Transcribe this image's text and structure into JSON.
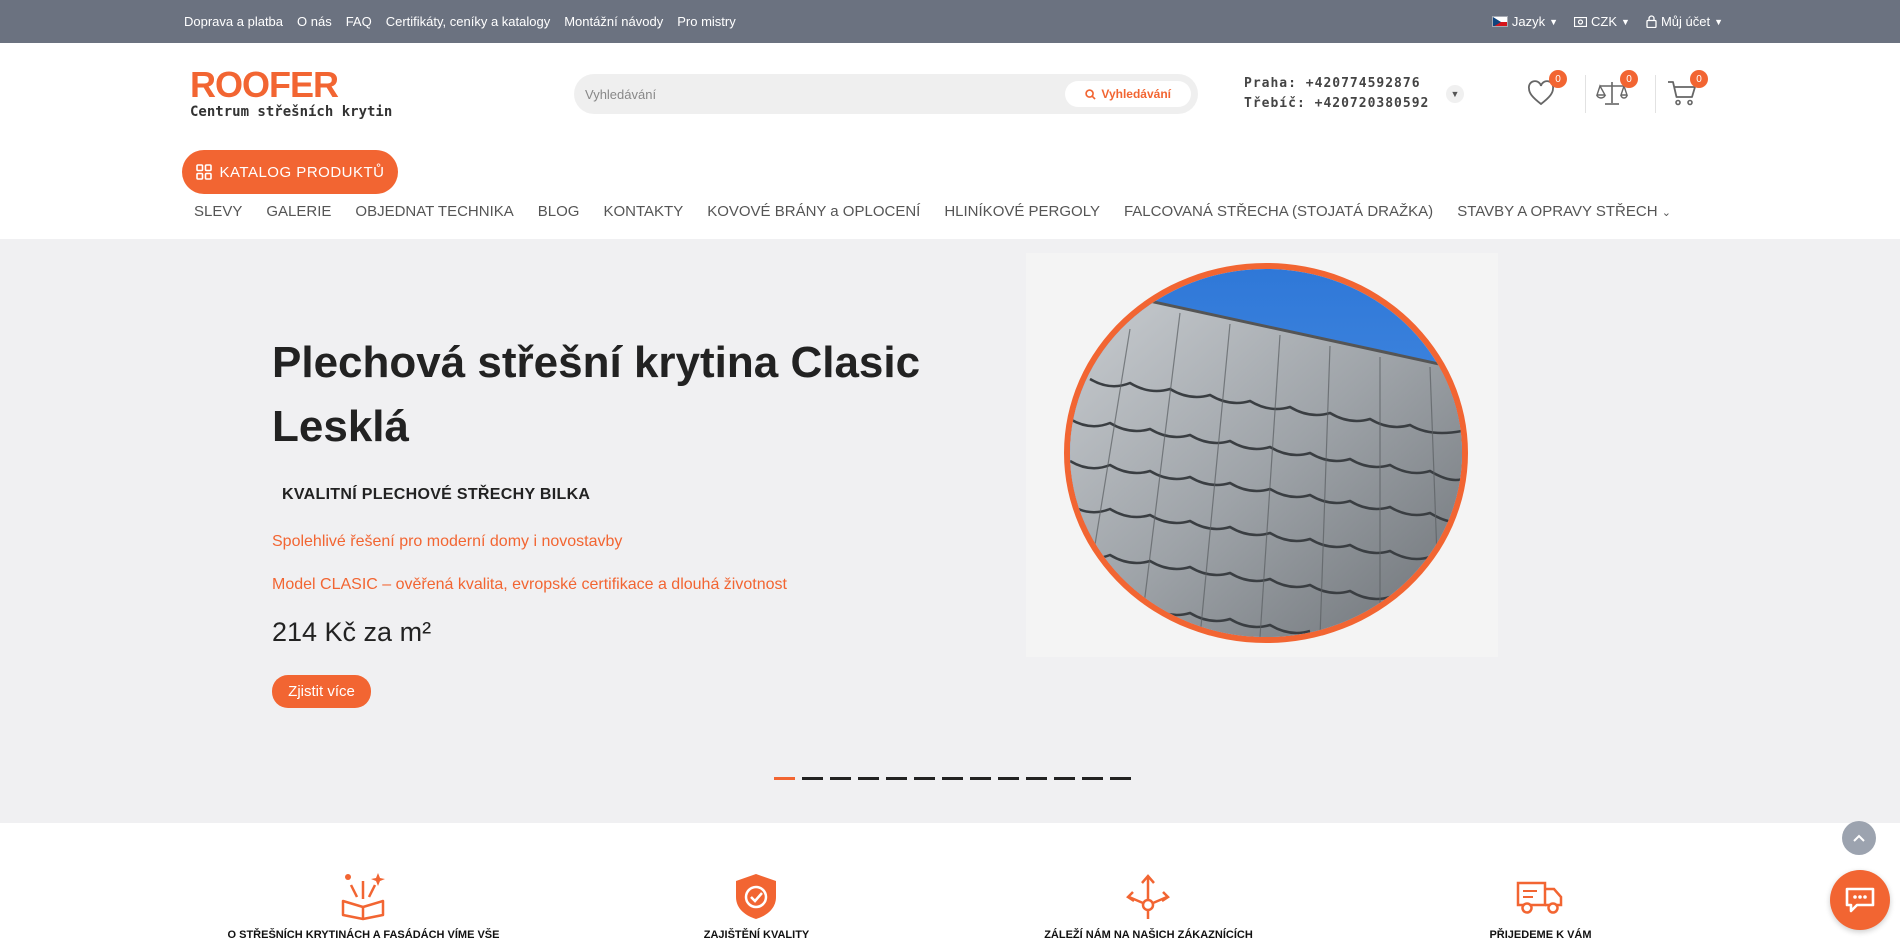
{
  "topbar": {
    "links": [
      "Doprava a platba",
      "O nás",
      "FAQ",
      "Certifikáty, ceníky a katalogy",
      "Montážní návody",
      "Pro mistry"
    ],
    "language": "Jazyk",
    "currency": "CZK",
    "account": "Můj účet"
  },
  "header": {
    "logo_word": "ROOFER",
    "logo_sub": "Centrum střešních krytin",
    "search_placeholder": "Vyhledávání",
    "search_button": "Vyhledávání",
    "phone_praha": "Praha: +420774592876",
    "phone_trebic": "Třebíč: +420720380592",
    "wishlist_count": "0",
    "compare_count": "0",
    "cart_count": "0"
  },
  "nav": {
    "catalog_label": "KATALOG PRODUKTŮ",
    "items": [
      "SLEVY",
      "GALERIE",
      "OBJEDNAT TECHNIKA",
      "BLOG",
      "KONTAKTY",
      "KOVOVÉ BRÁNY a OPLOCENÍ",
      "HLINÍKOVÉ PERGOLY",
      "FALCOVANÁ STŘECHA (STOJATÁ DRAŽKA)",
      "STAVBY A OPRAVY STŘECH"
    ]
  },
  "hero": {
    "title": "Plechová střešní krytina Clasic Lesklá",
    "subtitle": "KVALITNÍ PLECHOVÉ STŘECHY BILKA",
    "line1": "Spolehlivé řešení pro moderní domy i novostavby",
    "line2": "Model CLASIC – ověřená kvalita, evropské certifikace a dlouhá životnost",
    "price": "214 Kč za m²",
    "button": "Zjistit více",
    "slide_count": 13,
    "active_slide": 1
  },
  "features": [
    {
      "icon": "book-icon",
      "text": "O STŘEŠNÍCH KRYTINÁCH A FASÁDÁCH VÍME VŠE"
    },
    {
      "icon": "shield-check-icon",
      "text": "ZAJIŠTĚNÍ KVALITY"
    },
    {
      "icon": "arrows-out-icon",
      "text": "ZÁLEŽÍ NÁM NA NAŠICH ZÁKAZNÍCÍCH"
    },
    {
      "icon": "truck-icon",
      "text": "PŘIJEDEME K VÁM"
    }
  ],
  "colors": {
    "accent": "#f26532",
    "topbar": "#6b7280",
    "hero_bg": "#f0f0f2"
  }
}
